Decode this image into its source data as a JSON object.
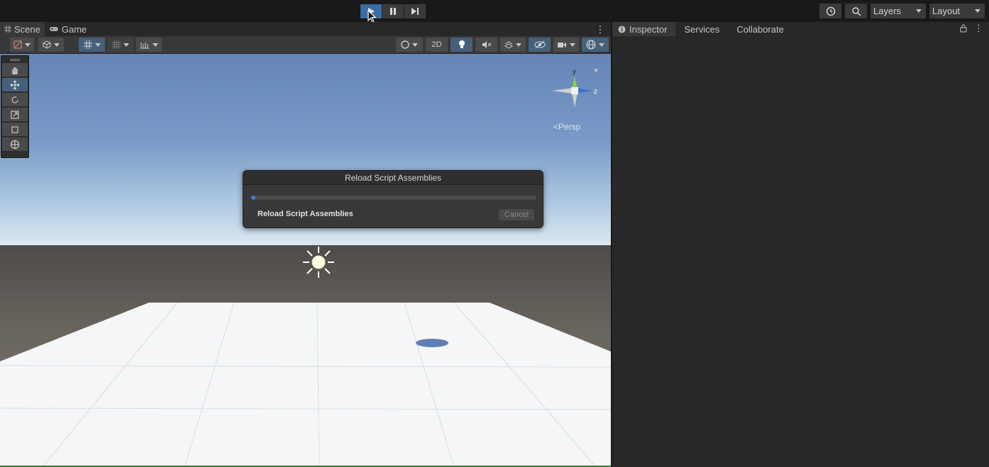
{
  "toolbar": {
    "play_label": "Play",
    "pause_label": "Pause",
    "step_label": "Step",
    "layers_label": "Layers",
    "layout_label": "Layout"
  },
  "scene_tabs": [
    {
      "label": "Scene",
      "icon": "grid-icon"
    },
    {
      "label": "Game",
      "icon": "gamepad-icon"
    }
  ],
  "scene_toolbar": {
    "mode_2d_label": "2D"
  },
  "gizmo": {
    "y_label": "y",
    "z_label": "z",
    "persp_label": "<Persp"
  },
  "dialog": {
    "title": "Reload Script Assemblies",
    "label": "Reload Script Assemblies",
    "cancel_label": "Cancel",
    "progress": 0.01
  },
  "inspector_tabs": [
    {
      "label": "Inspector",
      "icon": "info-icon"
    },
    {
      "label": "Services"
    },
    {
      "label": "Collaborate"
    }
  ],
  "colors": {
    "accent": "#3d6ba3",
    "progress": "#3d7be0",
    "sky_top": "#6485b6",
    "ground": "#6b655f"
  }
}
